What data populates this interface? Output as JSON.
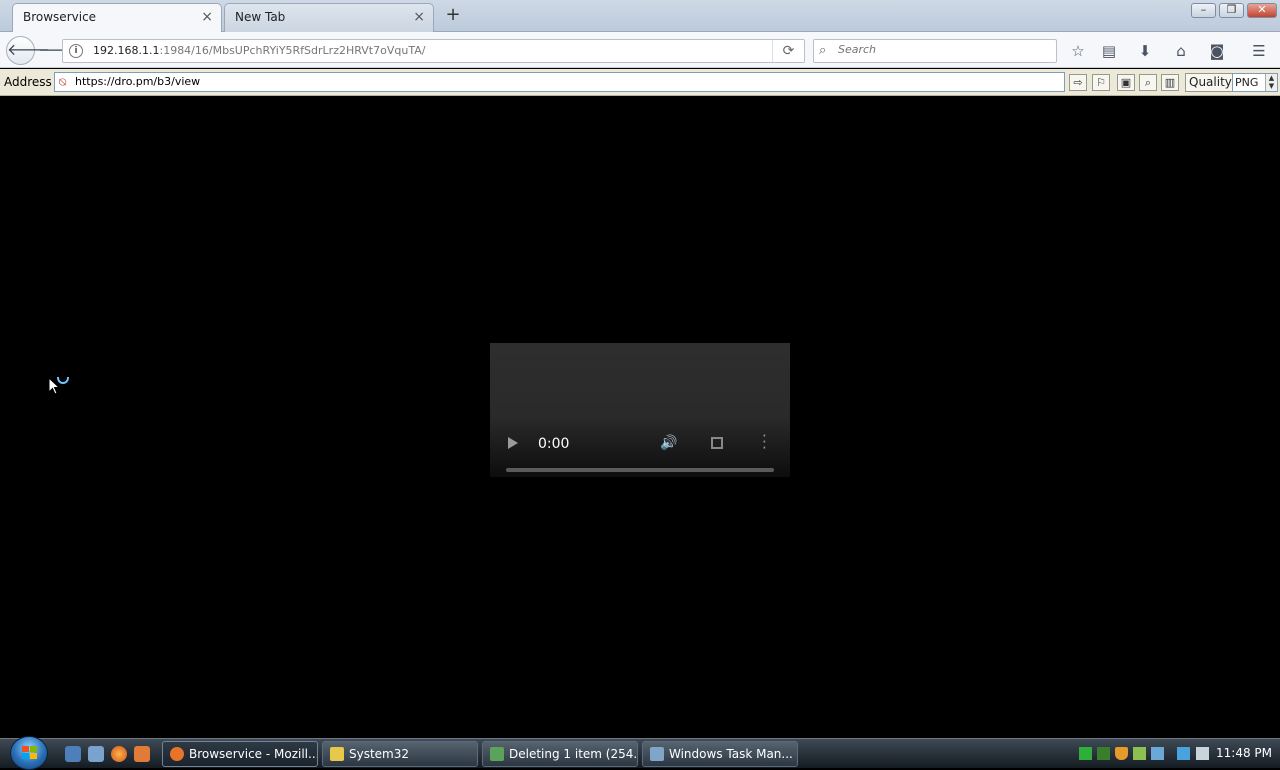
{
  "tabs": [
    {
      "label": "Browservice",
      "active": true
    },
    {
      "label": "New Tab",
      "active": false
    }
  ],
  "navbar": {
    "url_host": "192.168.1.1",
    "url_rest": ":1984/16/MbsUPchRYiY5RfSdrLrz2HRVt7oVquTA/",
    "search_placeholder": "Search"
  },
  "address_bar": {
    "label": "Address",
    "value": "https://dro.pm/b3/view",
    "quality_label": "Quality",
    "format_value": "PNG"
  },
  "video": {
    "time": "0:00",
    "progress_fraction": 0
  },
  "taskbar": {
    "tasks": [
      {
        "label": "Browservice - Mozill...",
        "color": "#e8742a",
        "active": true
      },
      {
        "label": "System32",
        "color": "#e8c84a",
        "active": false
      },
      {
        "label": "Deleting 1 item (254...",
        "color": "#5aa35a",
        "active": false
      },
      {
        "label": "Windows Task Man...",
        "color": "#7fa6c9",
        "active": false
      }
    ],
    "clock": "11:48 PM"
  },
  "colors": {
    "content_background": "#000000",
    "cursor_ring": "#6ec6ff"
  }
}
